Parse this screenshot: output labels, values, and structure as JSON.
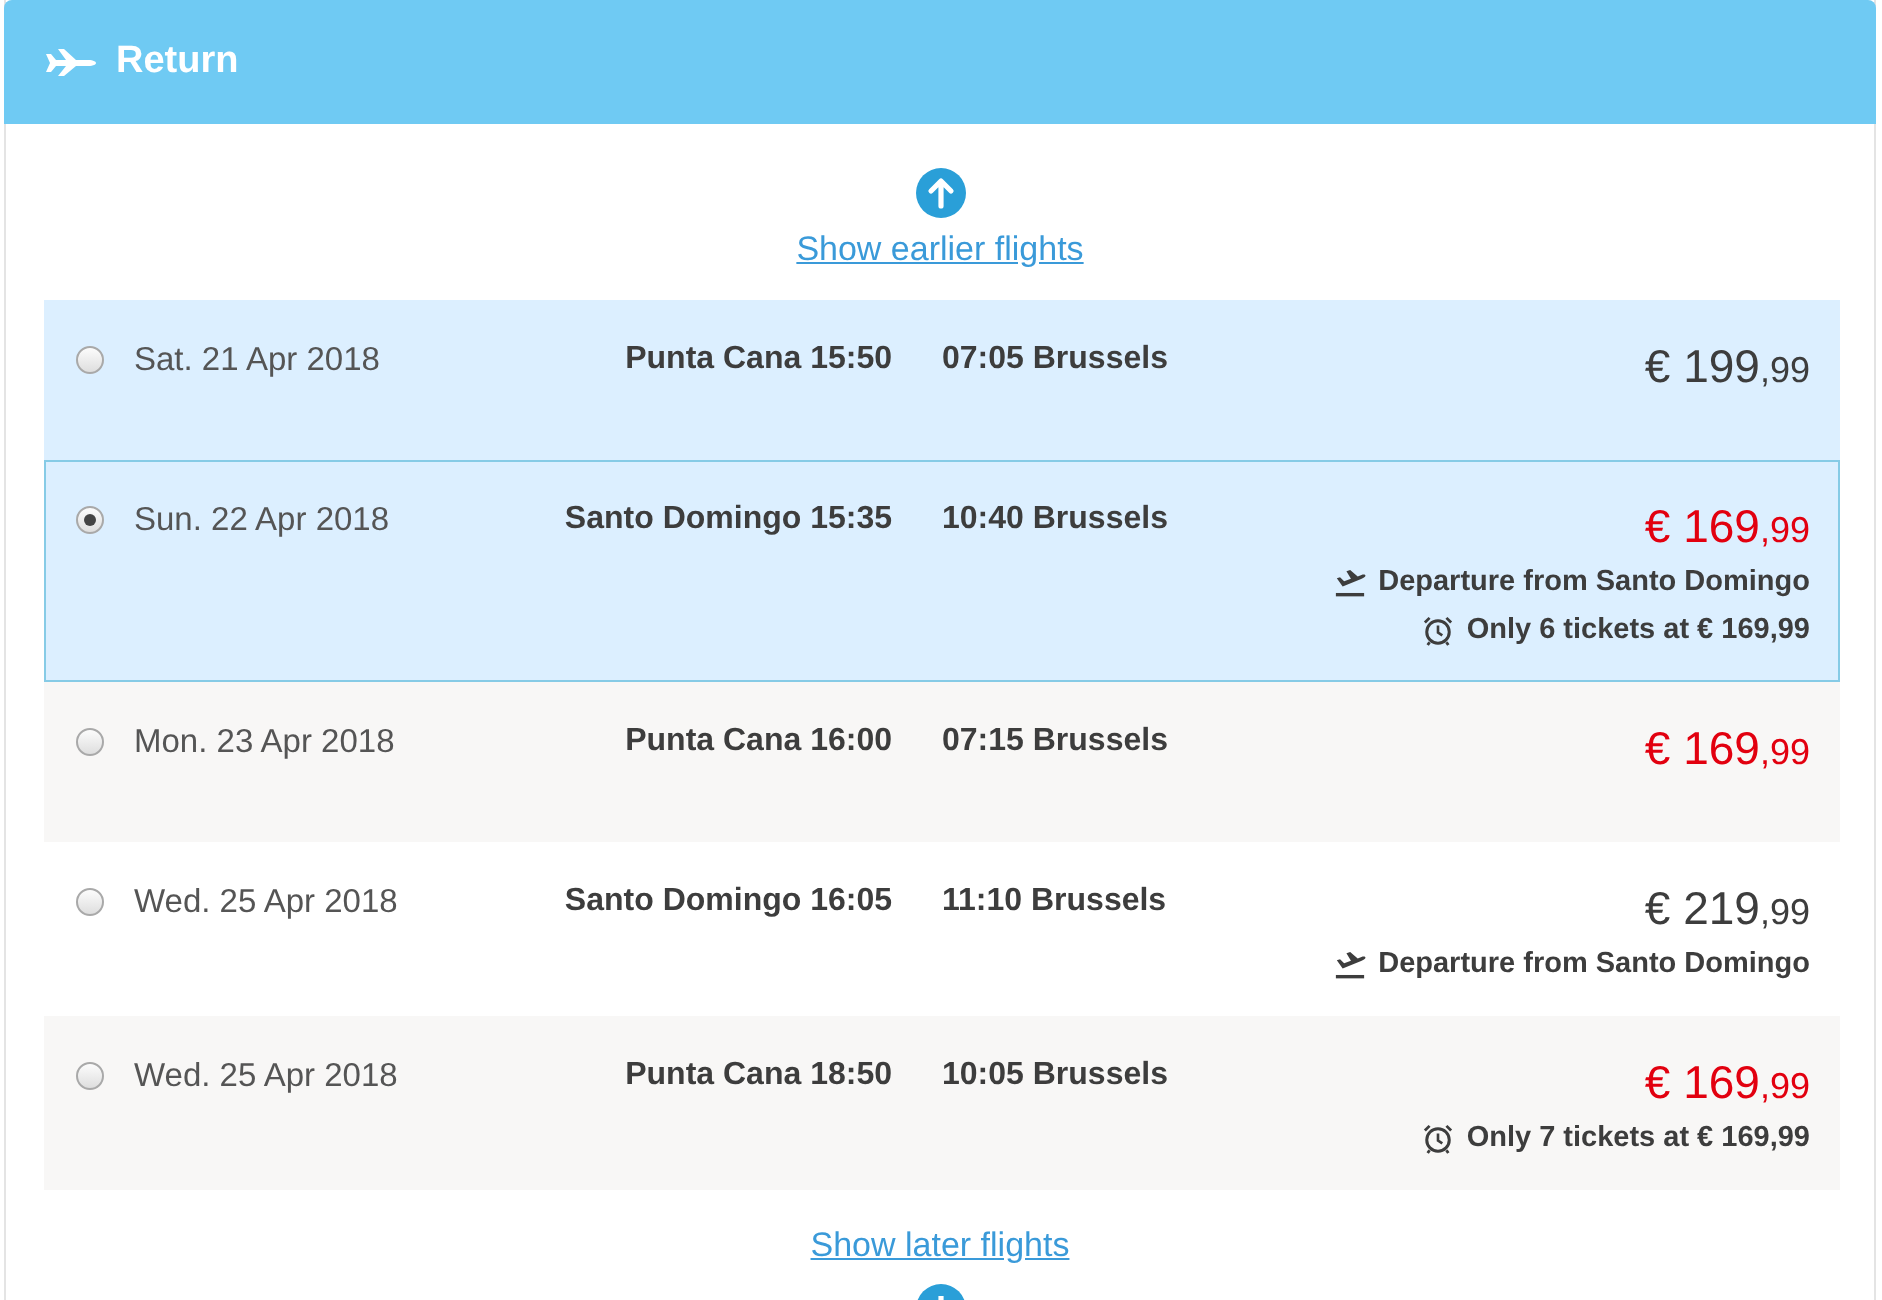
{
  "section": {
    "title": "Return"
  },
  "earlier": {
    "label": "Show earlier flights"
  },
  "flights": [
    {
      "date": "Sat. 21 Apr 2018",
      "departure": "Punta Cana 15:50",
      "arrival": "07:05 Brussels",
      "price": "€ 199",
      "price_cents": ",99",
      "cheapest": false,
      "selected": false,
      "hovered": true
    },
    {
      "date": "Sun. 22 Apr 2018",
      "departure": "Santo Domingo 15:35",
      "arrival": "10:40 Brussels",
      "price": "€ 169",
      "price_cents": ",99",
      "cheapest": true,
      "selected": true,
      "hovered": false,
      "notes": [
        {
          "kind": "departure",
          "text": "Departure from Santo Domingo"
        },
        {
          "kind": "tickets",
          "text": "Only 6 tickets at € 169,99"
        }
      ]
    },
    {
      "date": "Mon. 23 Apr 2018",
      "departure": "Punta Cana 16:00",
      "arrival": "07:15 Brussels",
      "price": "€ 169",
      "price_cents": ",99",
      "cheapest": true,
      "selected": false,
      "hovered": false
    },
    {
      "date": "Wed. 25 Apr 2018",
      "departure": "Santo Domingo 16:05",
      "arrival": "11:10 Brussels",
      "price": "€ 219",
      "price_cents": ",99",
      "cheapest": false,
      "selected": false,
      "hovered": false,
      "notes": [
        {
          "kind": "departure",
          "text": "Departure from Santo Domingo"
        }
      ]
    },
    {
      "date": "Wed. 25 Apr 2018",
      "departure": "Punta Cana 18:50",
      "arrival": "10:05 Brussels",
      "price": "€ 169",
      "price_cents": ",99",
      "cheapest": true,
      "selected": false,
      "hovered": false,
      "notes": [
        {
          "kind": "tickets",
          "text": "Only 7 tickets at € 169,99"
        }
      ]
    }
  ],
  "later": {
    "label": "Show later flights"
  }
}
